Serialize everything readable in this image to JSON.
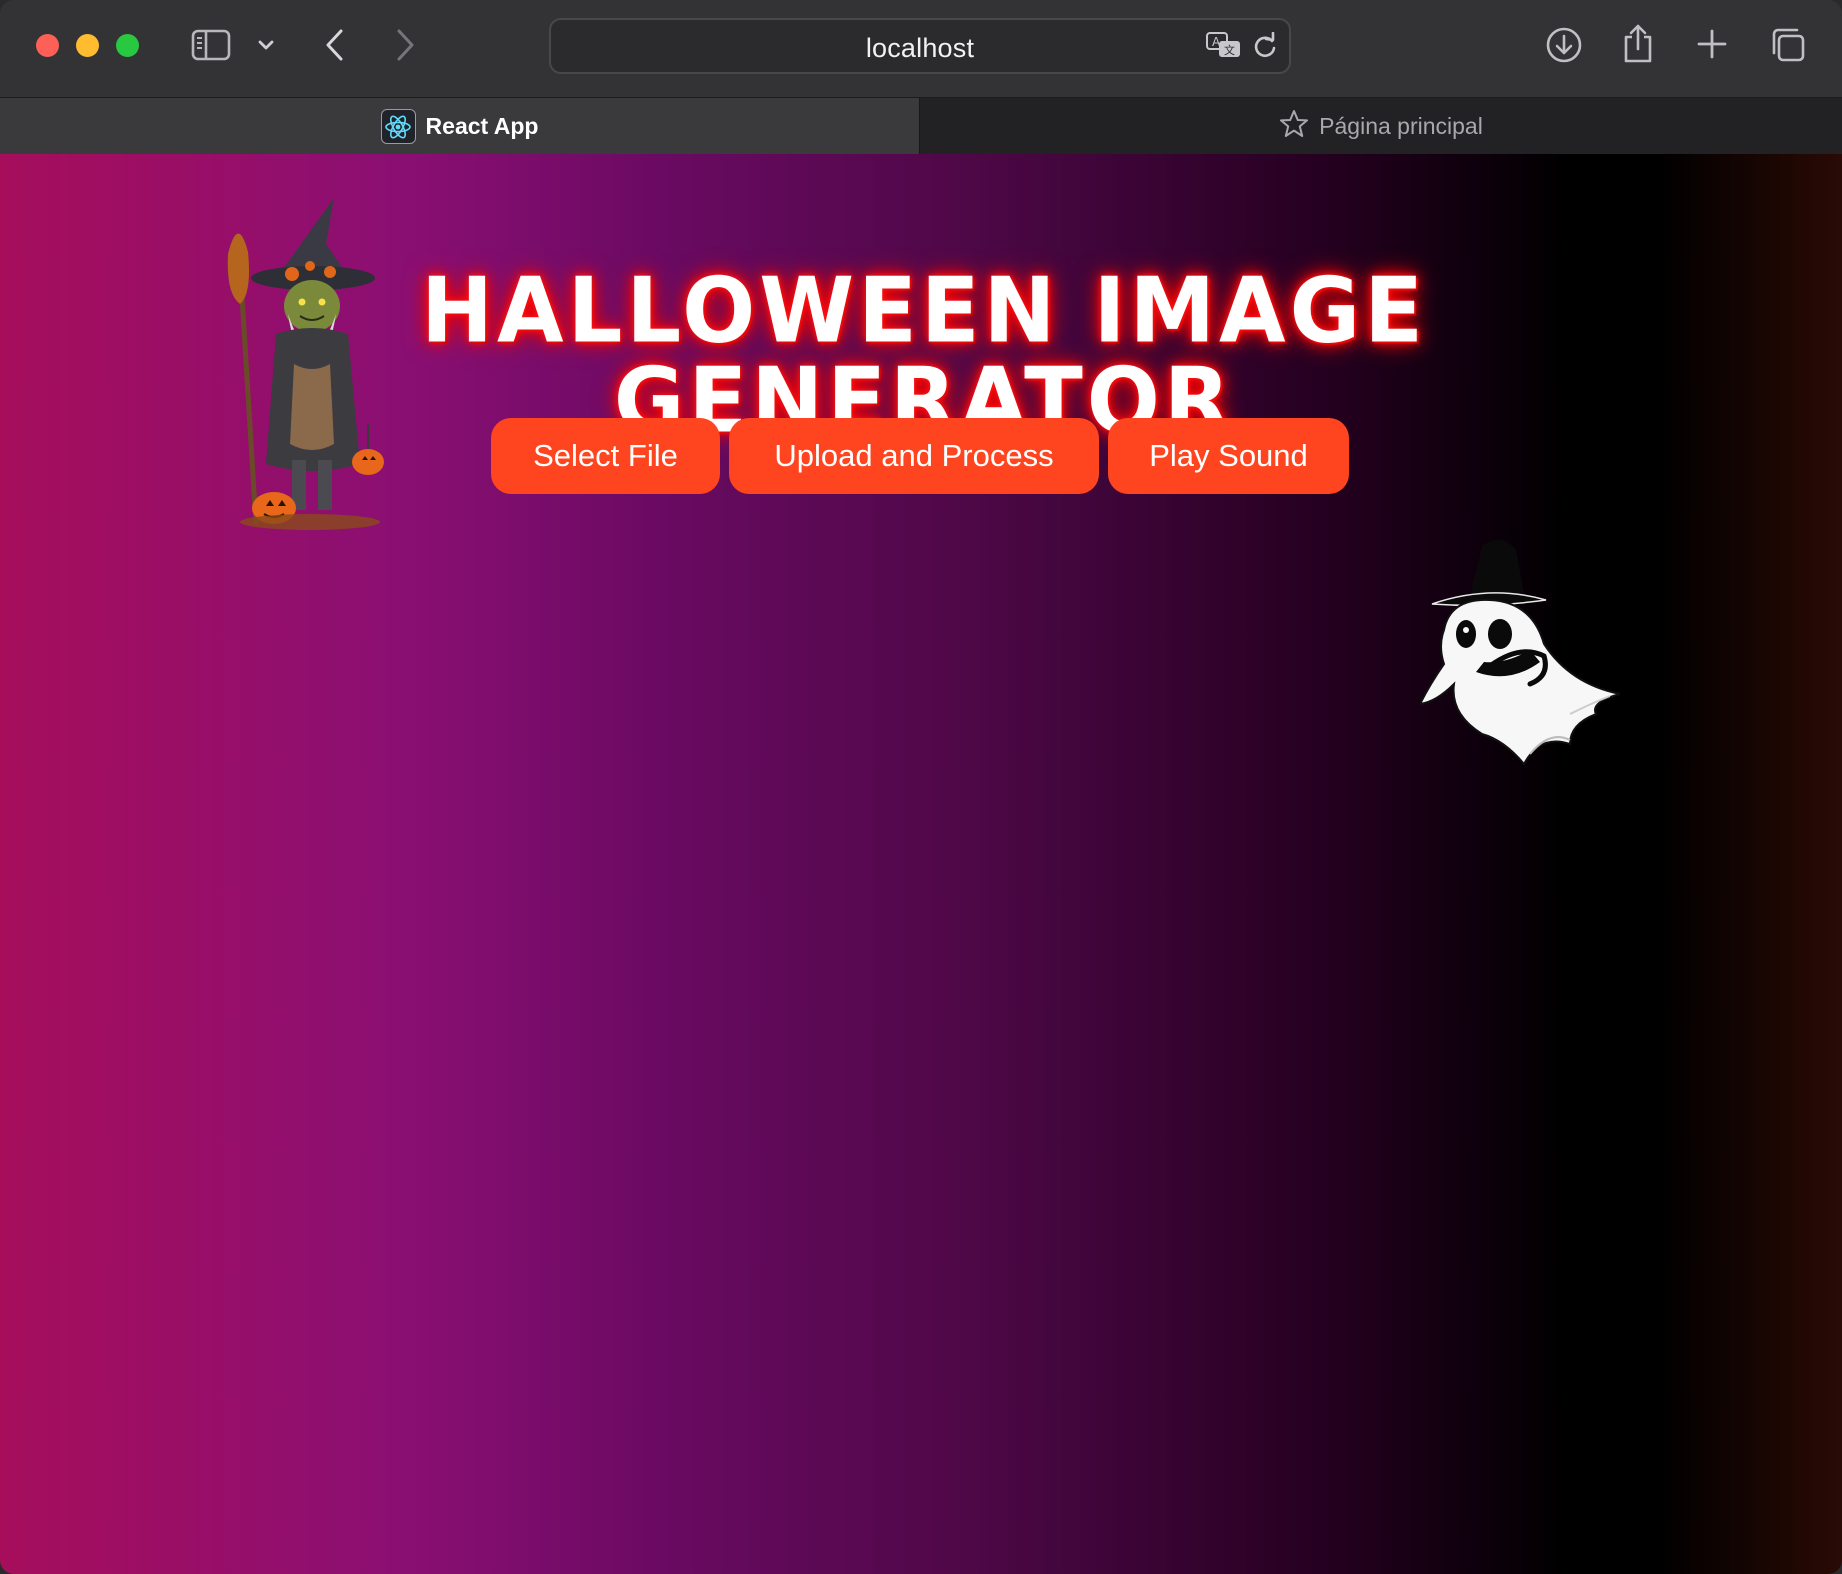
{
  "browser": {
    "address": "localhost",
    "tabs": [
      {
        "label": "React App",
        "active": true,
        "icon": "react-logo-icon"
      },
      {
        "label": "Página principal",
        "active": false,
        "icon": "star-icon"
      }
    ],
    "toolbar_icons": [
      "sidebar-icon",
      "chevron-down-icon",
      "back-icon",
      "forward-icon",
      "translate-icon",
      "reload-icon",
      "download-icon",
      "share-icon",
      "new-tab-icon",
      "tab-overview-icon"
    ]
  },
  "app": {
    "title": "HALLOWEEN IMAGE GENERATOR",
    "buttons": {
      "select_file": "Select File",
      "upload": "Upload and Process",
      "play_sound": "Play Sound"
    },
    "colors": {
      "button": "#fe451f",
      "title_glow": "#ff0000",
      "gradient": [
        "#a60e5c",
        "#8a0f73",
        "#4f0848",
        "#000000",
        "#2a0a04"
      ]
    },
    "images": [
      "goblin-witch-image",
      "ghost-image"
    ]
  }
}
